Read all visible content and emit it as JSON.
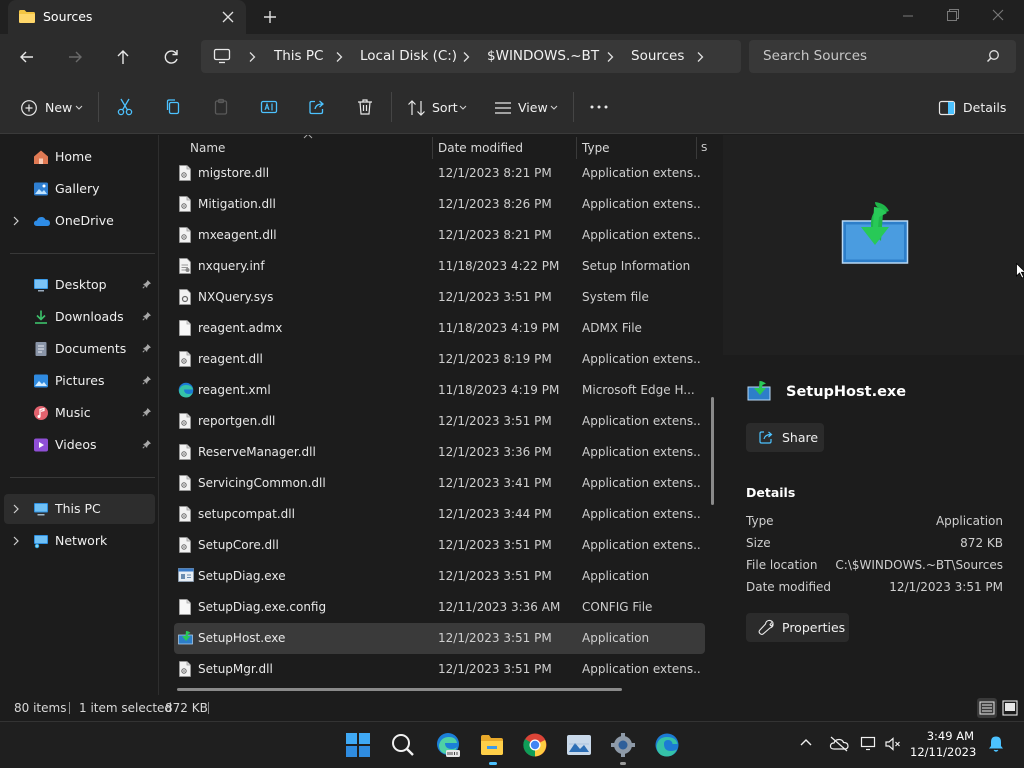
{
  "window": {
    "tab_title": "Sources"
  },
  "address": {
    "crumbs": [
      "This PC",
      "Local Disk (C:)",
      "$WINDOWS.~BT",
      "Sources"
    ]
  },
  "search": {
    "placeholder": "Search Sources"
  },
  "commands": {
    "new_label": "New",
    "sort_label": "Sort",
    "view_label": "View",
    "details_label": "Details"
  },
  "sidebar": {
    "items": [
      {
        "label": "Home",
        "icon": "home-icon"
      },
      {
        "label": "Gallery",
        "icon": "gallery-icon"
      },
      {
        "label": "OneDrive",
        "icon": "onedrive-icon"
      },
      {
        "label": "Desktop",
        "icon": "desktop-icon"
      },
      {
        "label": "Downloads",
        "icon": "downloads-icon"
      },
      {
        "label": "Documents",
        "icon": "documents-icon"
      },
      {
        "label": "Pictures",
        "icon": "pictures-icon"
      },
      {
        "label": "Music",
        "icon": "music-icon"
      },
      {
        "label": "Videos",
        "icon": "videos-icon"
      },
      {
        "label": "This PC",
        "icon": "this-pc-icon"
      },
      {
        "label": "Network",
        "icon": "network-icon"
      }
    ]
  },
  "columns": {
    "name": "Name",
    "date": "Date modified",
    "type": "Type",
    "size_trunc": "S"
  },
  "files": [
    {
      "name": "migstore.dll",
      "date": "12/1/2023 8:21 PM",
      "type": "Application extens...",
      "icon": "dll-file-icon"
    },
    {
      "name": "Mitigation.dll",
      "date": "12/1/2023 8:26 PM",
      "type": "Application extens...",
      "icon": "dll-file-icon"
    },
    {
      "name": "mxeagent.dll",
      "date": "12/1/2023 8:21 PM",
      "type": "Application extens...",
      "icon": "dll-file-icon"
    },
    {
      "name": "nxquery.inf",
      "date": "11/18/2023 4:22 PM",
      "type": "Setup Information",
      "icon": "inf-file-icon"
    },
    {
      "name": "NXQuery.sys",
      "date": "12/1/2023 3:51 PM",
      "type": "System file",
      "icon": "sys-file-icon"
    },
    {
      "name": "reagent.admx",
      "date": "11/18/2023 4:19 PM",
      "type": "ADMX File",
      "icon": "blank-file-icon"
    },
    {
      "name": "reagent.dll",
      "date": "12/1/2023 8:19 PM",
      "type": "Application extens...",
      "icon": "dll-file-icon"
    },
    {
      "name": "reagent.xml",
      "date": "11/18/2023 4:19 PM",
      "type": "Microsoft Edge H...",
      "icon": "edge-file-icon"
    },
    {
      "name": "reportgen.dll",
      "date": "12/1/2023 3:51 PM",
      "type": "Application extens...",
      "icon": "dll-file-icon"
    },
    {
      "name": "ReserveManager.dll",
      "date": "12/1/2023 3:36 PM",
      "type": "Application extens...",
      "icon": "dll-file-icon"
    },
    {
      "name": "ServicingCommon.dll",
      "date": "12/1/2023 3:41 PM",
      "type": "Application extens...",
      "icon": "dll-file-icon"
    },
    {
      "name": "setupcompat.dll",
      "date": "12/1/2023 3:44 PM",
      "type": "Application extens...",
      "icon": "dll-file-icon"
    },
    {
      "name": "SetupCore.dll",
      "date": "12/1/2023 3:51 PM",
      "type": "Application extens...",
      "icon": "dll-file-icon"
    },
    {
      "name": "SetupDiag.exe",
      "date": "12/1/2023 3:51 PM",
      "type": "Application",
      "icon": "exe-file-icon"
    },
    {
      "name": "SetupDiag.exe.config",
      "date": "12/11/2023 3:36 AM",
      "type": "CONFIG File",
      "icon": "blank-file-icon"
    },
    {
      "name": "SetupHost.exe",
      "date": "12/1/2023 3:51 PM",
      "type": "Application",
      "icon": "setuphost-icon",
      "selected": true
    },
    {
      "name": "SetupMgr.dll",
      "date": "12/1/2023 3:51 PM",
      "type": "Application extens...",
      "icon": "dll-file-icon"
    }
  ],
  "details": {
    "file_name": "SetupHost.exe",
    "share_label": "Share",
    "section_title": "Details",
    "props": [
      {
        "key": "Type",
        "value": "Application"
      },
      {
        "key": "Size",
        "value": "872 KB"
      },
      {
        "key": "File location",
        "value": "C:\\$WINDOWS.~BT\\Sources"
      },
      {
        "key": "Date modified",
        "value": "12/1/2023 3:51 PM"
      }
    ],
    "properties_label": "Properties"
  },
  "status": {
    "count": "80 items",
    "selection": "1 item selected",
    "size": "872 KB"
  },
  "clock": {
    "time": "3:49 AM",
    "date": "12/11/2023"
  },
  "colors": {
    "accent": "#4cc2ff",
    "folder": "#f4c542",
    "selection": "#3a3a3a"
  }
}
